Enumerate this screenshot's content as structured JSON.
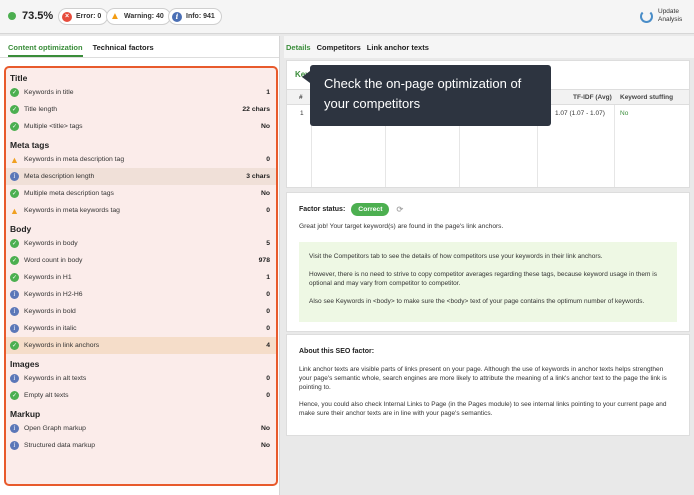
{
  "topbar": {
    "score": "73.5%",
    "error": "Error: 0",
    "warning": "Warning: 40",
    "info": "Info: 941",
    "update": "Update Analysis"
  },
  "left_tabs": [
    "Content optimization",
    "Technical factors"
  ],
  "groups": [
    {
      "title": "Title",
      "rows": [
        {
          "status": "ok",
          "name": "Keywords in title",
          "value": "1"
        },
        {
          "status": "ok",
          "name": "Title length",
          "value": "22 chars"
        },
        {
          "status": "ok",
          "name": "Multiple <title> tags",
          "value": "No"
        }
      ]
    },
    {
      "title": "Meta tags",
      "rows": [
        {
          "status": "warn",
          "name": "Keywords in meta description tag",
          "value": "0"
        },
        {
          "status": "info",
          "name": "Meta description length",
          "value": "3 chars"
        },
        {
          "status": "ok",
          "name": "Multiple meta description tags",
          "value": "No"
        },
        {
          "status": "warn",
          "name": "Keywords in meta keywords tag",
          "value": "0"
        }
      ]
    },
    {
      "title": "Body",
      "rows": [
        {
          "status": "ok",
          "name": "Keywords in body",
          "value": "5"
        },
        {
          "status": "ok",
          "name": "Word count in body",
          "value": "978"
        },
        {
          "status": "ok",
          "name": "Keywords in H1",
          "value": "1"
        },
        {
          "status": "info",
          "name": "Keywords in H2-H6",
          "value": "0"
        },
        {
          "status": "info",
          "name": "Keywords in bold",
          "value": "0"
        },
        {
          "status": "info",
          "name": "Keywords in italic",
          "value": "0"
        },
        {
          "status": "ok",
          "name": "Keywords in link anchors",
          "value": "4"
        }
      ]
    },
    {
      "title": "Images",
      "rows": [
        {
          "status": "info",
          "name": "Keywords in alt texts",
          "value": "0"
        },
        {
          "status": "ok",
          "name": "Empty alt texts",
          "value": "0"
        }
      ]
    },
    {
      "title": "Markup",
      "rows": [
        {
          "status": "info",
          "name": "Open Graph markup",
          "value": "No"
        },
        {
          "status": "info",
          "name": "Structured data markup",
          "value": "No"
        }
      ]
    }
  ],
  "right_tabs": [
    "Details",
    "Competitors",
    "Link anchor texts"
  ],
  "table": {
    "keyword_label": "Keyw",
    "col_num": "#",
    "col_tfidf": "TF-IDF (Avg)",
    "col_stuffing": "Keyword stuffing",
    "row_num": "1",
    "row_tfidf": "1.07 (1.07 - 1.07)",
    "row_stuffing": "No"
  },
  "tooltip": "Check the on-page optimization of your competitors",
  "details": {
    "factor_status_label": "Factor status:",
    "badge": "Correct",
    "great": "Great job! Your target keyword(s) are found in the page's link anchors.",
    "note1": "Visit the Competitors tab to see the details of how competitors use your keywords in their link anchors.",
    "note2": "However, there is no need to strive to copy competitor averages regarding these tags, because keyword usage in them is optional and may vary from competitor to competitor.",
    "note3": "Also see Keywords in <body> to make sure the <body> text of your page contains the optimum number of keywords."
  },
  "about": {
    "title": "About this SEO factor:",
    "p1": "Link anchor texts are visible parts of links present on your page. Although the use of keywords in anchor texts helps strengthen your page's semantic whole, search engines are more likely to attribute the meaning of a link's anchor text to the page the link is pointing to.",
    "p2": "Hence, you could also check Internal Links to Page (in the Pages module) to see internal links pointing to your current page and make sure their anchor texts are in line with your page's semantics."
  },
  "colors": {
    "accent": "#3a8d3a",
    "highlight_border": "#e85a2c",
    "ok": "#4caf50",
    "warn": "#f0a020",
    "info": "#5b77b8"
  }
}
